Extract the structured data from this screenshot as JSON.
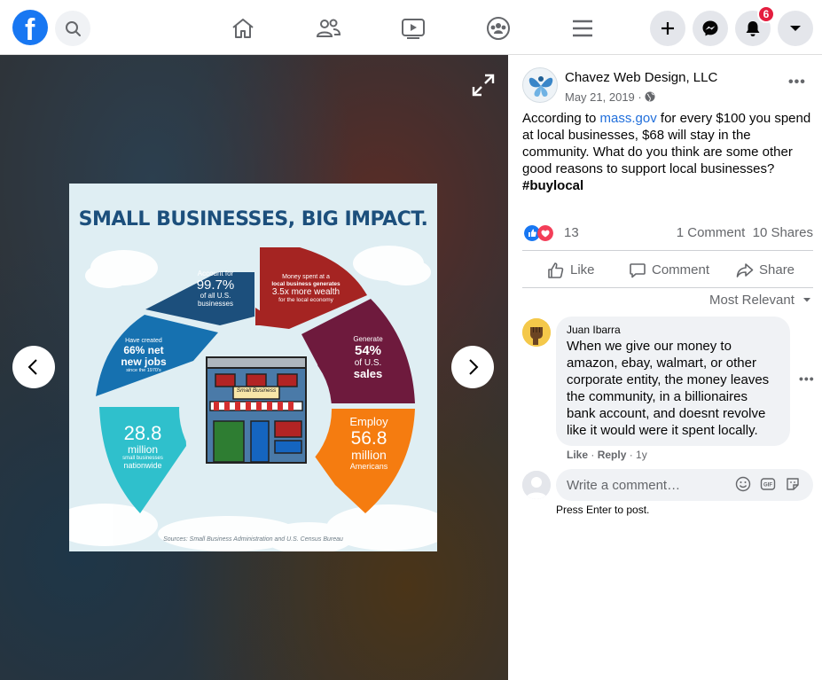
{
  "topbar": {
    "logo_letter": "f",
    "notification_count": "6"
  },
  "infographic": {
    "title": "SMALL BUSINESSES, BIG IMPACT.",
    "store_sign": "Small Business",
    "segments": [
      {
        "lines": [
          "Account for",
          "99.7%",
          "of all U.S.",
          "businesses"
        ],
        "color": "#1c4f7c"
      },
      {
        "lines": [
          "Money spent at a",
          "local business generates",
          "3.5x more wealth",
          "for the local economy"
        ],
        "color": "#a52422"
      },
      {
        "lines": [
          "Generate",
          "54%",
          "of U.S.",
          "sales"
        ],
        "color": "#6e1a3d"
      },
      {
        "lines": [
          "Employ",
          "56.8",
          "million",
          "Americans"
        ],
        "color": "#f57c10"
      },
      {
        "lines": [
          "28.8",
          "million",
          "small businesses",
          "nationwide"
        ],
        "color": "#2fc0cc"
      },
      {
        "lines": [
          "Have created",
          "66% net",
          "new jobs",
          "since the 1970's"
        ],
        "color": "#1671b0"
      }
    ],
    "source": "Sources: Small Business Administration and U.S. Census  Bureau"
  },
  "post": {
    "page_name": "Chavez Web Design, LLC",
    "date": "May 21, 2019 · ",
    "text_before_link": "According to ",
    "link_text": "mass.gov",
    "text_after_link": " for every $100 you spend at local businesses, $68 will stay in the community. What do you think are some other good reasons to support local businesses? ",
    "hashtag": "#buylocal",
    "reaction_count": "13",
    "comments_count": "1 Comment",
    "shares_count": "10 Shares"
  },
  "actions": {
    "like": "Like",
    "comment": "Comment",
    "share": "Share"
  },
  "comments": {
    "sort_label": "Most Relevant",
    "items": [
      {
        "author": "Juan Ibarra",
        "text": "When we give our money to amazon, ebay, walmart, or other corporate entity, the money leaves the community, in a billionaires bank account, and doesnt revolve like it would were it spent locally.",
        "like_label": "Like",
        "reply_label": "Reply",
        "time": "1y"
      }
    ],
    "write_placeholder": "Write a comment…",
    "press_enter": "Press Enter to post."
  },
  "colors": {
    "facebook_blue": "#1877f2",
    "link": "#216fdb",
    "notification_red": "#e41e3f"
  },
  "icons": [
    "facebook-logo",
    "search-icon",
    "home-icon",
    "friends-icon",
    "watch-icon",
    "groups-icon",
    "menu-icon",
    "plus-icon",
    "messenger-icon",
    "bell-icon",
    "caret-down-icon",
    "expand-icon",
    "chevron-left-icon",
    "chevron-right-icon",
    "globe-icon",
    "like-reaction-icon",
    "love-reaction-icon",
    "thumbs-up-icon",
    "comment-icon",
    "share-icon",
    "emoji-icon",
    "gif-icon",
    "sticker-icon"
  ]
}
